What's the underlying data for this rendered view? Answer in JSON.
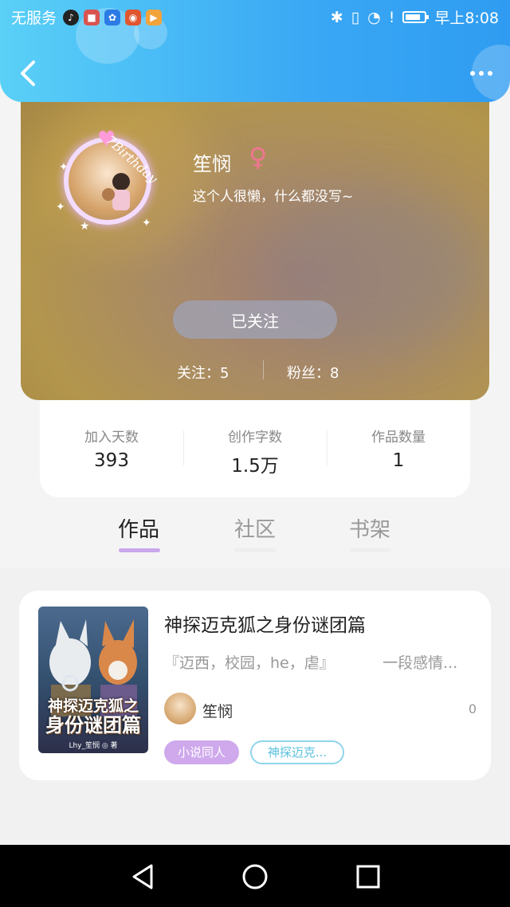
{
  "status_bar": {
    "carrier": "无服务",
    "time": "早上8:08",
    "apps": [
      {
        "icon": "tiktok-icon",
        "color": "#222222",
        "glyph": "♪"
      },
      {
        "icon": "app-red-icon",
        "color": "#d9534f",
        "glyph": "■"
      },
      {
        "icon": "baidu-icon",
        "color": "#2c7be5",
        "glyph": "✿"
      },
      {
        "icon": "weibo-icon",
        "color": "#e0562f",
        "glyph": "◉"
      },
      {
        "icon": "video-icon",
        "color": "#f3a33b",
        "glyph": "▶"
      }
    ]
  },
  "profile": {
    "nickname": "笙悯",
    "gender_icon": "♀",
    "bio": "这个人很懒，什么都没写~",
    "avatar_frame_text": "7Birthday",
    "follow_button": "已关注",
    "following": "关注：5",
    "fans": "粉丝：8"
  },
  "stats": [
    {
      "label": "加入天数",
      "value": "393"
    },
    {
      "label": "创作字数",
      "value": "1.5万"
    },
    {
      "label": "作品数量",
      "value": "1"
    }
  ],
  "tabs": [
    {
      "label": "作品",
      "active": true
    },
    {
      "label": "社区",
      "active": false
    },
    {
      "label": "书架",
      "active": false
    }
  ],
  "colors": {
    "header": "#3aa8f4",
    "active_tab_underline": "#c9a7ec",
    "inactive_tab_underline": "#eeeeee"
  },
  "work": {
    "title": "神探迈克狐之身份谜团篇",
    "desc": "『迈西，校园，he，虐』          一段感情...",
    "cover_title_line1": "神探迈克狐之",
    "cover_title_line2": "身份谜团篇",
    "cover_author": "Lhy_笙悯 ◎ 著",
    "author": "笙悯",
    "count": "0",
    "tags": [
      "小说同人",
      "神探迈克..."
    ]
  }
}
